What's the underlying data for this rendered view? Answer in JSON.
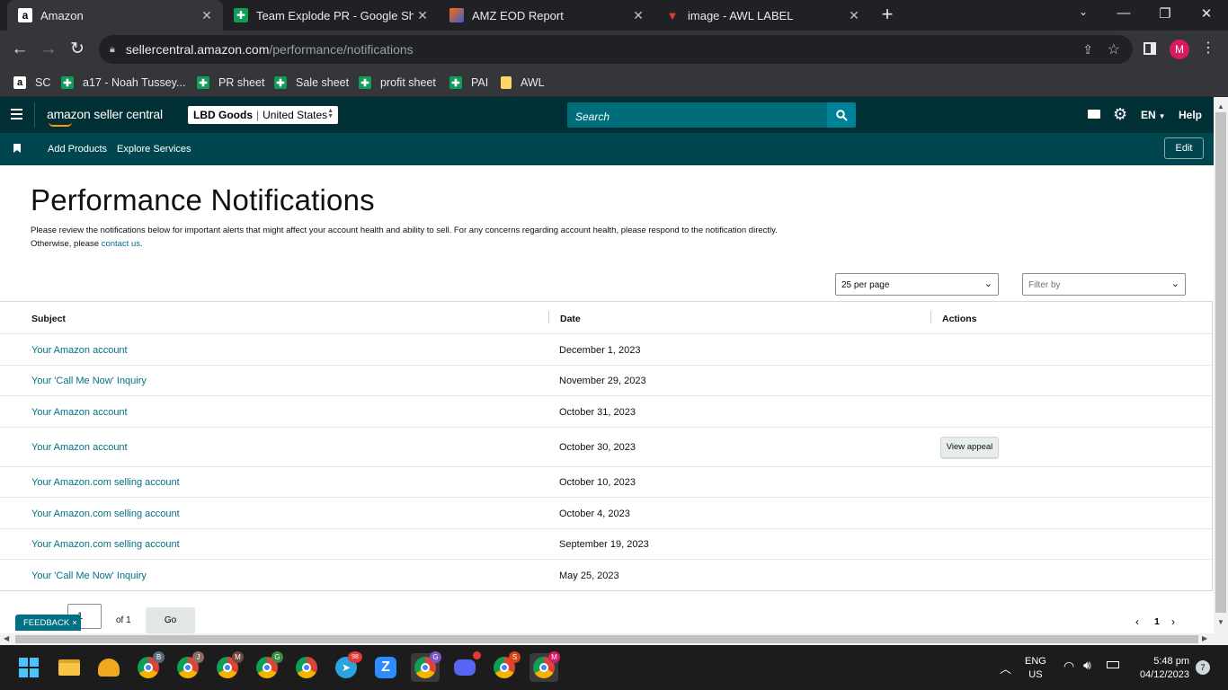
{
  "browser": {
    "tabs": [
      {
        "title": "Amazon",
        "icon": "amazon-icon",
        "active": true
      },
      {
        "title": "Team Explode PR - Google Shee",
        "icon": "sheets-icon"
      },
      {
        "title": "AMZ EOD Report",
        "icon": "eod-icon"
      },
      {
        "title": "image - AWL LABEL",
        "icon": "awl-icon"
      }
    ],
    "new_tab": "+",
    "url_domain": "sellercentral.amazon.com",
    "url_path": "/performance/notifications",
    "profile": "M",
    "bookmarks": [
      {
        "label": "SC",
        "icon": "amazon-icon"
      },
      {
        "label": "a17 - Noah Tussey...",
        "icon": "sheets-icon"
      },
      {
        "label": "PR sheet",
        "icon": "sheets-icon"
      },
      {
        "label": "Sale sheet",
        "icon": "sheets-icon"
      },
      {
        "label": "profit sheet",
        "icon": "sheets-icon"
      },
      {
        "label": "PAI",
        "icon": "sheets-icon"
      },
      {
        "label": "AWL",
        "icon": "folder-icon"
      }
    ]
  },
  "sc": {
    "logo": "amazon seller central",
    "account": "LBD Goods",
    "marketplace": "United States",
    "search_placeholder": "Search",
    "lang": "EN",
    "help": "Help",
    "nav": [
      "Add Products",
      "Explore Services"
    ],
    "edit": "Edit"
  },
  "main": {
    "title": "Performance Notifications",
    "desc": "Please review the notifications below for important alerts that might affect your account health and ability to sell. For any concerns regarding account health, please respond to the notification directly. Otherwise, please",
    "desc_link": "contact us.",
    "per_page": "25 per page",
    "filter": "Filter by",
    "columns": [
      "Subject",
      "Date",
      "Actions"
    ],
    "rows": [
      {
        "subject": "Your Amazon account",
        "date": "December 1, 2023",
        "action": ""
      },
      {
        "subject": "Your 'Call Me Now' Inquiry",
        "date": "November 29, 2023",
        "action": ""
      },
      {
        "subject": "Your Amazon account",
        "date": "October 31, 2023",
        "action": ""
      },
      {
        "subject": "Your Amazon account",
        "date": "October 30, 2023",
        "action": "View appeal"
      },
      {
        "subject": "Your Amazon.com selling account",
        "date": "October 10, 2023",
        "action": ""
      },
      {
        "subject": "Your Amazon.com selling account",
        "date": "October 4, 2023",
        "action": ""
      },
      {
        "subject": "Your Amazon.com selling account",
        "date": "September 19, 2023",
        "action": ""
      },
      {
        "subject": "Your 'Call Me Now' Inquiry",
        "date": "May 25, 2023",
        "action": ""
      }
    ],
    "pager": {
      "page_value": "1",
      "of": "of 1",
      "go": "Go",
      "current": "1"
    },
    "feedback": "FEEDBACK"
  },
  "taskbar": {
    "lang": "ENG",
    "region": "US",
    "time": "5:48 pm",
    "date": "04/12/2023",
    "notif_count": "7",
    "telegram_badge": "98"
  },
  "colors": {
    "sc_header": "#002f36",
    "sc_subnav": "#00464f",
    "link": "#007185",
    "search": "#006d7a"
  }
}
